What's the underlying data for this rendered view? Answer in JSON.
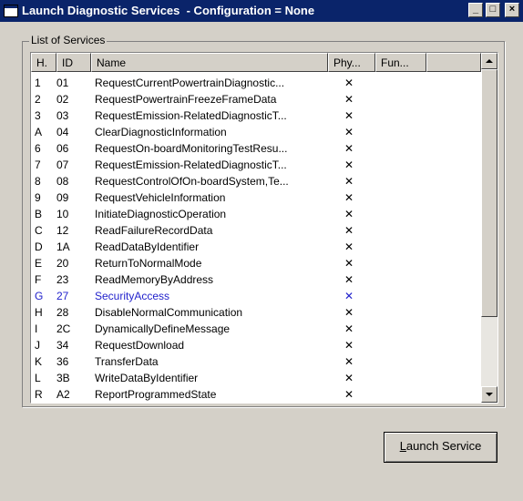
{
  "window": {
    "title": "Launch Diagnostic Services  - Configuration = None",
    "minimize_glyph": "_",
    "maximize_glyph": "□",
    "close_glyph": "×"
  },
  "services_group": {
    "legend": "List of Services",
    "columns": [
      "H.",
      "ID",
      "Name",
      "Phy...",
      "Fun..."
    ],
    "selected_index": 13,
    "rows": [
      {
        "h": "1",
        "id": "01",
        "name": "RequestCurrentPowertrainDiagnostic...",
        "phy": "✕",
        "fun": ""
      },
      {
        "h": "2",
        "id": "02",
        "name": "RequestPowertrainFreezeFrameData",
        "phy": "✕",
        "fun": ""
      },
      {
        "h": "3",
        "id": "03",
        "name": "RequestEmission-RelatedDiagnosticT...",
        "phy": "✕",
        "fun": ""
      },
      {
        "h": "A",
        "id": "04",
        "name": "ClearDiagnosticInformation",
        "phy": "✕",
        "fun": ""
      },
      {
        "h": "6",
        "id": "06",
        "name": "RequestOn-boardMonitoringTestResu...",
        "phy": "✕",
        "fun": ""
      },
      {
        "h": "7",
        "id": "07",
        "name": "RequestEmission-RelatedDiagnosticT...",
        "phy": "✕",
        "fun": ""
      },
      {
        "h": "8",
        "id": "08",
        "name": "RequestControlOfOn-boardSystem,Te...",
        "phy": "✕",
        "fun": ""
      },
      {
        "h": "9",
        "id": "09",
        "name": "RequestVehicleInformation",
        "phy": "✕",
        "fun": ""
      },
      {
        "h": "B",
        "id": "10",
        "name": "InitiateDiagnosticOperation",
        "phy": "✕",
        "fun": ""
      },
      {
        "h": "C",
        "id": "12",
        "name": "ReadFailureRecordData",
        "phy": "✕",
        "fun": ""
      },
      {
        "h": "D",
        "id": "1A",
        "name": "ReadDataByIdentifier",
        "phy": "✕",
        "fun": ""
      },
      {
        "h": "E",
        "id": "20",
        "name": "ReturnToNormalMode",
        "phy": "✕",
        "fun": ""
      },
      {
        "h": "F",
        "id": "23",
        "name": "ReadMemoryByAddress",
        "phy": "✕",
        "fun": ""
      },
      {
        "h": "G",
        "id": "27",
        "name": "SecurityAccess",
        "phy": "✕",
        "fun": ""
      },
      {
        "h": "H",
        "id": "28",
        "name": "DisableNormalCommunication",
        "phy": "✕",
        "fun": ""
      },
      {
        "h": "I",
        "id": "2C",
        "name": "DynamicallyDefineMessage",
        "phy": "✕",
        "fun": ""
      },
      {
        "h": "J",
        "id": "34",
        "name": "RequestDownload",
        "phy": "✕",
        "fun": ""
      },
      {
        "h": "K",
        "id": "36",
        "name": "TransferData",
        "phy": "✕",
        "fun": ""
      },
      {
        "h": "L",
        "id": "3B",
        "name": "WriteDataByIdentifier",
        "phy": "✕",
        "fun": ""
      },
      {
        "h": "R",
        "id": "A2",
        "name": "ReportProgrammedState",
        "phy": "✕",
        "fun": ""
      }
    ]
  },
  "launch_button": {
    "label": "Launch Service",
    "accelerator": "L"
  },
  "colors": {
    "titlebar": "#0a246a",
    "dialog_bg": "#d4d0c8",
    "selected_row_text": "#2222cc"
  }
}
